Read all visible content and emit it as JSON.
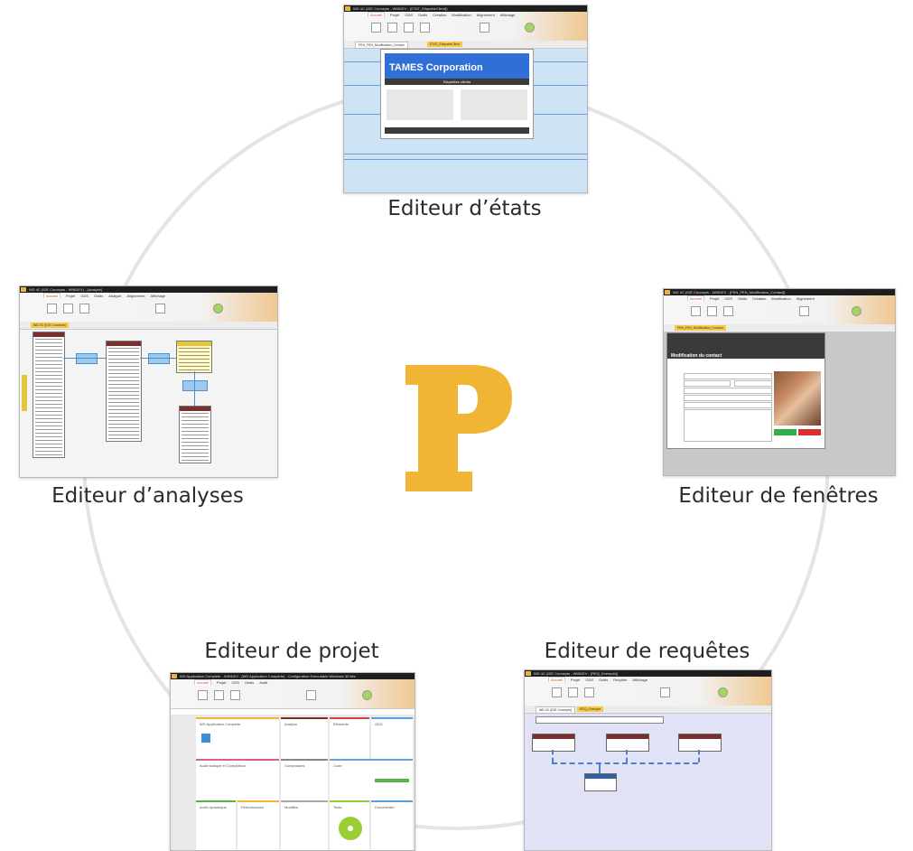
{
  "logo": {
    "letter": "P",
    "color": "#f0b535"
  },
  "ring_color": "#e4e4e4",
  "editors": {
    "etats": {
      "caption": "Editeur d’états",
      "title_bar": "WD 4C (IDE Concepts - WINDEV - [ETAT_EtiquetteClient])",
      "company": "TAMES Corporation",
      "subtitle": "Etiquettes clients",
      "doc_tab_active": "ETAT_EtiquetteClient",
      "doc_tab_other": "FEN_FEN_Modification_Contact"
    },
    "analyses": {
      "caption": "Editeur d’analyses",
      "title_bar": "WD 4C (IDE Concepts - WINDEV) - [Analyse]",
      "doc_tab": "WD 4C (IDE Concepts)",
      "tables": [
        "Client",
        "Commande",
        "LigneCommande",
        "Produit"
      ],
      "relations": [
        "0,N effectue / 1,1",
        "1,N contient / 1,1",
        "0,N Est ligne de / 1,1"
      ]
    },
    "fenetres": {
      "caption": "Editeur de fenêtres",
      "title_bar": "WD 4C (IDE Concepts - WINDEV - [FEN_FEN_Modification_Contact])",
      "doc_tab": "FEN_FEN_Modification_Contact",
      "window_title": "Modification du contact",
      "ok_label": "Valider",
      "cancel_label": "Annuler"
    },
    "projet": {
      "caption": "Editeur de projet",
      "title_bar": "WD Application Complete - WINDEV - [WD Application Complete] - Configuration Executable Windows 32 bits",
      "panels": [
        "WD Application Complete",
        "Analyse",
        "Éléments",
        "GDS",
        "Audit statique et Compilation",
        "Composants",
        "Code",
        "Audit dynamique",
        "Performances",
        "Modifiés",
        "Tests",
        "Documenter"
      ]
    },
    "requetes": {
      "caption": "Editeur de requêtes",
      "title_bar": "WD 4C (IDE Concepts - WINDEV - [REQ_Exemple])",
      "doc_tab": "REQ_Exemple",
      "doc_tab_other": "WD 4C (IDE Concepts)",
      "tables": [
        "Client",
        "Commande",
        "LigneCommande",
        "Produit"
      ]
    }
  }
}
